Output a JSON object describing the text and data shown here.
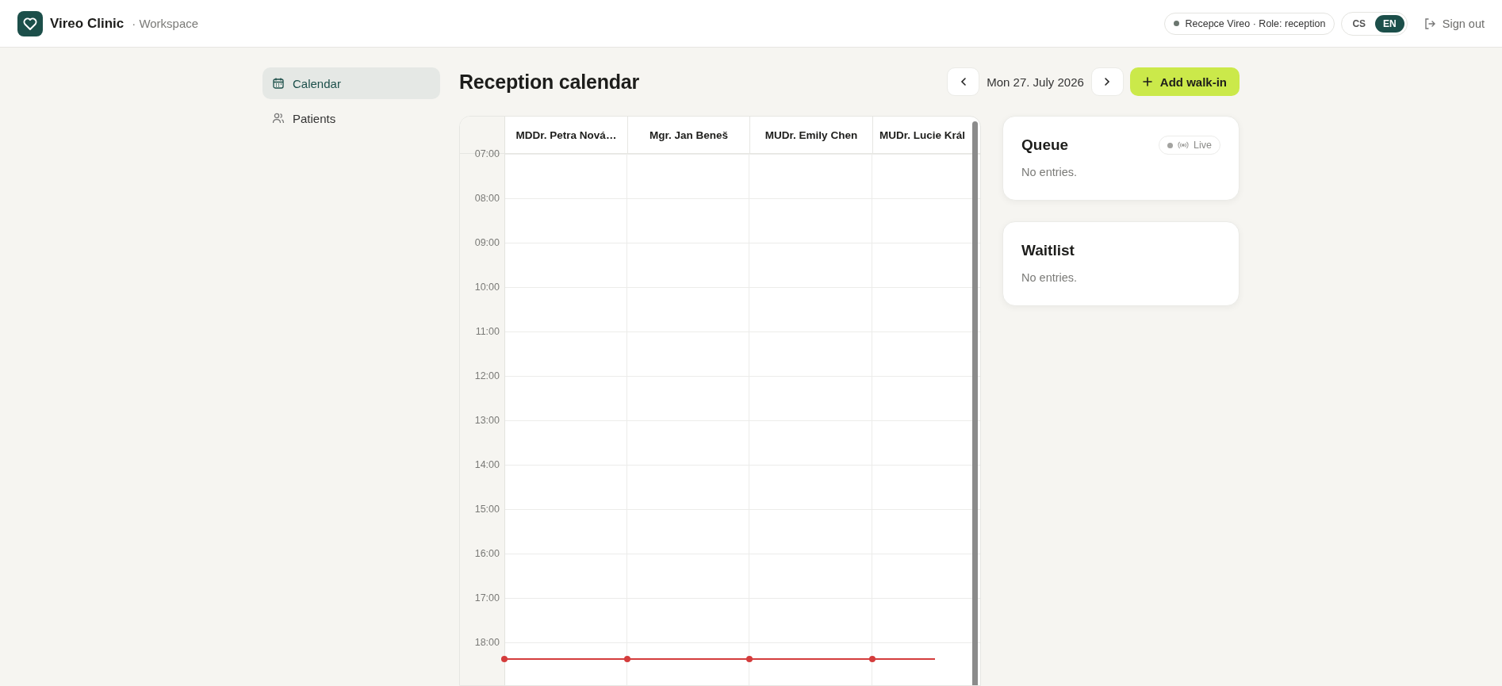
{
  "header": {
    "brand": "Vireo Clinic",
    "subtitle": "· Workspace",
    "user_status": "Recepce Vireo · Role: reception",
    "languages": [
      {
        "label": "CS",
        "selected": false
      },
      {
        "label": "EN",
        "selected": true
      }
    ],
    "sign_out": "Sign out"
  },
  "sidebar": {
    "items": [
      {
        "label": "Calendar",
        "kind": "calendar",
        "selected": true
      },
      {
        "label": "Patients",
        "kind": "people",
        "selected": false
      }
    ]
  },
  "page": {
    "title": "Reception calendar",
    "date": "Mon 27. July 2026",
    "add_button": "Add walk-in"
  },
  "calendar": {
    "columns": [
      "MDDr. Petra Nová…",
      "Mgr. Jan Beneš",
      "MUDr. Emily Chen",
      "MUDr. Lucie Král"
    ],
    "hours": [
      "07:00",
      "08:00",
      "09:00",
      "10:00",
      "11:00",
      "12:00",
      "13:00",
      "14:00",
      "15:00",
      "16:00",
      "17:00",
      "18:00"
    ]
  },
  "queue": {
    "title": "Queue",
    "live": {
      "label": "Live",
      "active": false
    },
    "empty": "No entries."
  },
  "waitlist": {
    "title": "Waitlist",
    "empty": "No entries."
  }
}
